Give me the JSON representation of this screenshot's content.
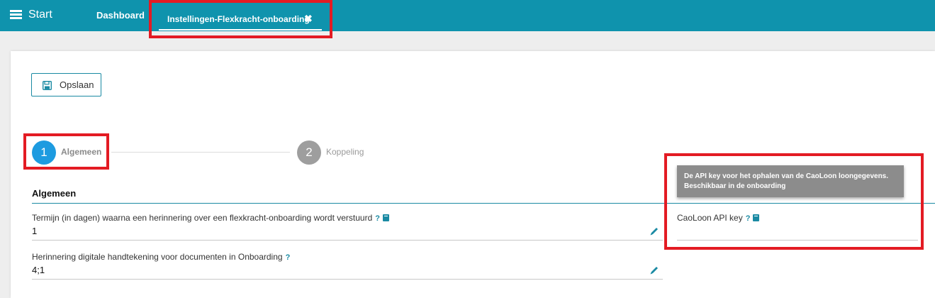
{
  "header": {
    "menu_label": "Start",
    "tabs": [
      {
        "label": "Dashboard"
      },
      {
        "label": "Instellingen-Flexkracht-onboarding",
        "close_glyph": "✖"
      }
    ]
  },
  "toolbar": {
    "save_label": "Opslaan"
  },
  "stepper": {
    "steps": [
      {
        "number": "1",
        "label": "Algemeen"
      },
      {
        "number": "2",
        "label": "Koppeling"
      }
    ]
  },
  "section": {
    "title": "Algemeen"
  },
  "fields": [
    {
      "label": "Termijn (in dagen) waarna een herinnering over een flexkracht-onboarding wordt verstuurd",
      "help": "?",
      "value": "1"
    },
    {
      "label": "Herinnering digitale handtekening voor documenten in Onboarding",
      "help": "?",
      "value": "4;1"
    },
    {
      "label": "CaoLoon API key",
      "help": "?",
      "value": ""
    }
  ],
  "tooltip": {
    "line1": "De API key voor het ophalen van de CaoLoon loongegevens.",
    "line2": "Beschikbaar in de onboarding"
  },
  "icons": {
    "menu": "hamburger-icon",
    "close": "close-icon",
    "save": "floppy-disk-icon",
    "help": "question-mark-icon",
    "docs": "book-icon",
    "edit": "pencil-icon"
  },
  "colors": {
    "topbar": "#0f93ad",
    "accent": "#1a8aa3",
    "step_active": "#1d9be0",
    "step_inactive": "#9e9e9e",
    "highlight": "#e31b23",
    "tooltip_bg": "#8c8c8c"
  }
}
